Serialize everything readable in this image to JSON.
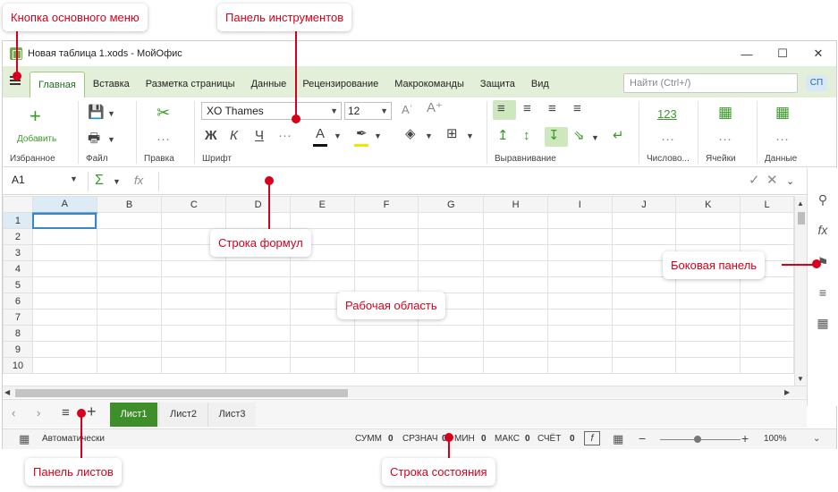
{
  "window": {
    "title": "Новая таблица 1.xods - МойОфис"
  },
  "window_controls": {
    "minimize": "—",
    "maximize": "☐",
    "close": "✕"
  },
  "menu": {
    "tabs": [
      "Главная",
      "Вставка",
      "Разметка страницы",
      "Данные",
      "Рецензирование",
      "Макрокоманды",
      "Защита",
      "Вид"
    ],
    "active_tab": "Главная",
    "search_placeholder": "Найти (Ctrl+/)",
    "user_initials": "СП"
  },
  "ribbon": {
    "groups": {
      "favorites": "Избранное",
      "file": "Файл",
      "edit": "Правка",
      "font": "Шрифт",
      "alignment": "Выравнивание",
      "number": "Числово...",
      "cells": "Ячейки",
      "data": "Данные"
    },
    "add_label": "Добавить",
    "font_name": "XO Thames",
    "font_size": "12",
    "bold": "Ж",
    "italic": "К",
    "underline": "Ч",
    "number_format": "123",
    "font_color_bar": "#111111",
    "highlight_color_bar": "#f5e600"
  },
  "formula_bar": {
    "cell_ref": "A1",
    "sum_icon": "Σ",
    "fx_icon": "fx"
  },
  "grid": {
    "columns": [
      "A",
      "B",
      "C",
      "D",
      "E",
      "F",
      "G",
      "H",
      "I",
      "J",
      "K",
      "L"
    ],
    "rows": [
      "1",
      "2",
      "3",
      "4",
      "5",
      "6",
      "7",
      "8",
      "9",
      "10"
    ]
  },
  "sheets": {
    "tabs": [
      "Лист1",
      "Лист2",
      "Лист3"
    ],
    "active": "Лист1"
  },
  "status": {
    "mode": "Автоматически",
    "sum_label": "СУММ",
    "sum_value": "0",
    "count_label": "СРЗНАЧ",
    "count_value": "0",
    "min_label": "МИН",
    "min_value": "0",
    "max_label": "МАКС",
    "max_value": "0",
    "countall_label": "СЧЁТ",
    "countall_value": "0",
    "zoom": "100%"
  },
  "callouts": {
    "main_menu": "Кнопка основного меню",
    "toolbar": "Панель инструментов",
    "formula_bar": "Строка формул",
    "side_panel": "Боковая панель",
    "work_area": "Рабочая область",
    "sheets_panel": "Панель листов",
    "status_bar": "Строка состояния"
  },
  "colors": {
    "accent_green": "#3e8f2c",
    "callout_red": "#d6001c",
    "tabbar_bg": "#e4efd9"
  }
}
